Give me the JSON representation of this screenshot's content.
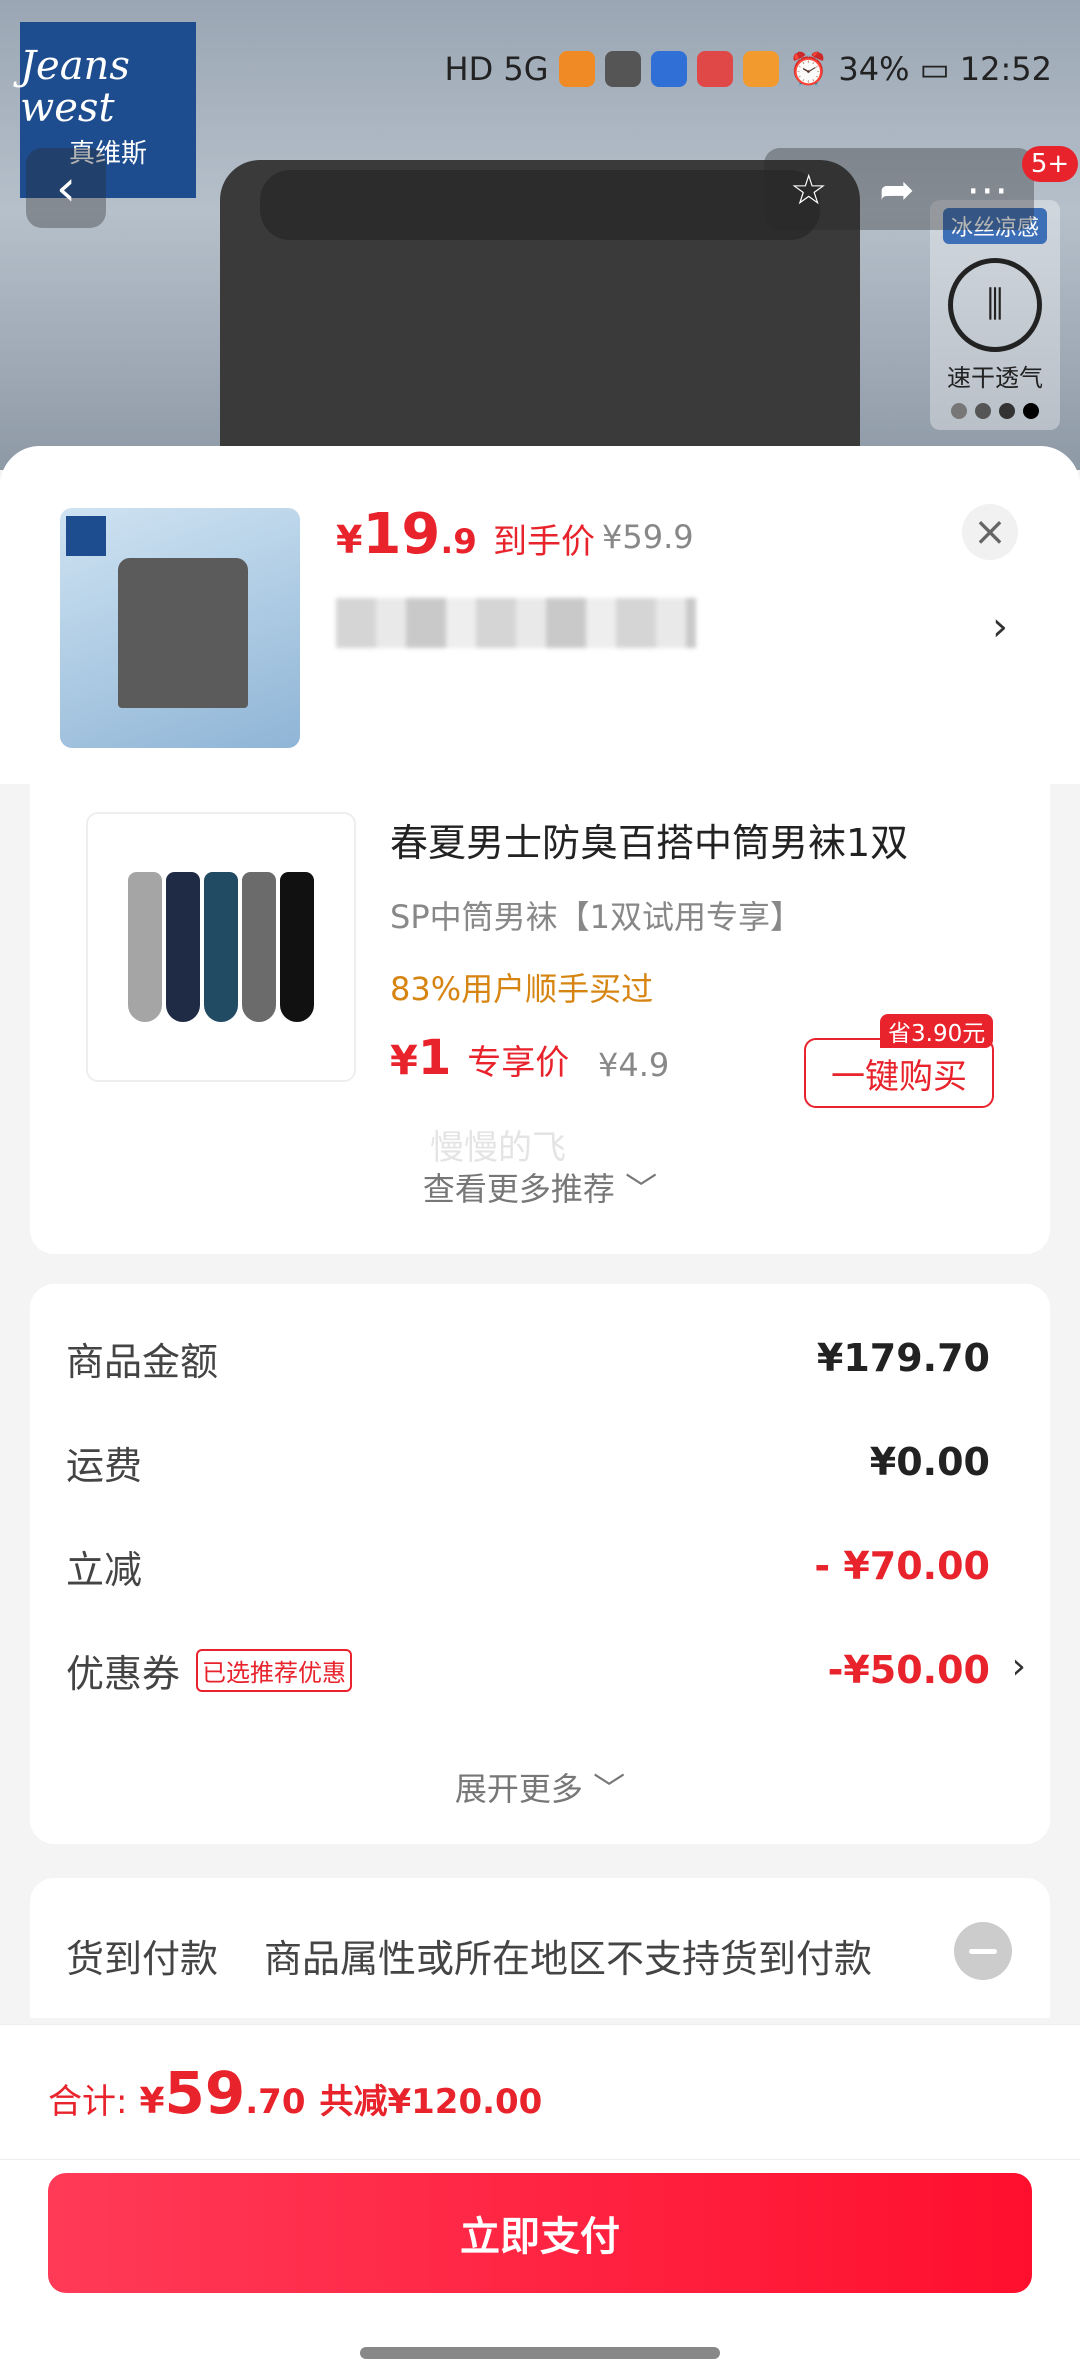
{
  "status_bar": {
    "signal": "HD 5G",
    "battery": "34%",
    "time": "12:52"
  },
  "hero": {
    "brand_en": "Jeans west",
    "brand_cn": "真维斯",
    "notification_count": "5+",
    "side_tag_1": "冰丝凉感",
    "side_tag_2": "速干透气"
  },
  "product": {
    "price_currency": "¥",
    "price_int": "19",
    "price_dec": ".9",
    "price_label": "到手价",
    "original_price": "¥59.9"
  },
  "recommendation": {
    "title": "春夏男士防臭百搭中筒男袜1双",
    "subtitle": "SP中筒男袜【1双试用专享】",
    "buyers": "83%用户顺手买过",
    "price_currency": "¥",
    "price": "1",
    "price_label": "专享价",
    "original_price": "¥4.9",
    "save_badge": "省3.90元",
    "buy_button": "一键购买",
    "watermark": "慢慢的飞",
    "more_link": "查看更多推荐 ﹀"
  },
  "summary": {
    "rows": [
      {
        "label": "商品金额",
        "value": "¥179.70"
      },
      {
        "label": "运费",
        "value": "¥0.00"
      },
      {
        "label": "立减",
        "value": "- ¥70.00"
      },
      {
        "label": "优惠券",
        "value": "-¥50.00"
      }
    ],
    "coupon_tag": "已选推荐优惠",
    "expand_link": "展开更多 ﹀"
  },
  "cod": {
    "label": "货到付款",
    "description": "商品属性或所在地区不支持货到付款"
  },
  "footer": {
    "total_label": "合计:",
    "total_currency": "¥",
    "total_int": "59",
    "total_dec": ".70",
    "total_saved": "共减¥120.00",
    "pay_button": "立即支付"
  },
  "colors": {
    "accent_red": "#e8232c",
    "buyers_orange": "#d68412",
    "pay_gradient_start": "#ff3a57",
    "pay_gradient_end": "#ff0f2e"
  },
  "icons": [
    "back-icon",
    "star-icon",
    "share-icon",
    "more-icon",
    "close-icon",
    "chevron-right-icon",
    "chevron-down-icon",
    "minus-circle-icon"
  ]
}
